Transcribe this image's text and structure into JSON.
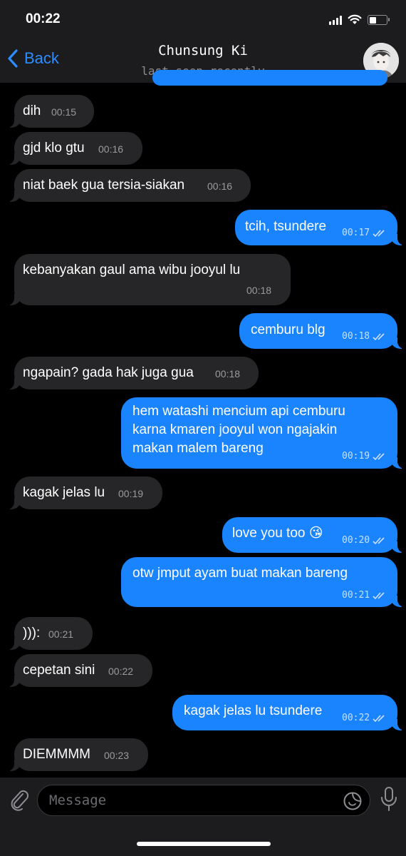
{
  "status": {
    "time": "00:22"
  },
  "nav": {
    "back_label": "Back",
    "contact_name": "Chunsung Ki",
    "contact_status": "last seen recently"
  },
  "messages": [
    {
      "dir": "in",
      "text": "dih",
      "time": "00:15"
    },
    {
      "dir": "in",
      "text": "gjd klo gtu",
      "time": "00:16"
    },
    {
      "dir": "in",
      "text": "niat baek gua tersia-siakan",
      "time": "00:16"
    },
    {
      "dir": "out",
      "text": "tcih, tsundere",
      "time": "00:17"
    },
    {
      "dir": "in",
      "text": "kebanyakan gaul ama wibu jooyul lu",
      "time": "00:18"
    },
    {
      "dir": "out",
      "text": "cemburu blg",
      "time": "00:18"
    },
    {
      "dir": "in",
      "text": "ngapain? gada hak juga gua",
      "time": "00:18"
    },
    {
      "dir": "out",
      "lines": [
        "hem watashi mencium api cemburu",
        "karna kmaren jooyul won ngajakin",
        "makan malem bareng"
      ],
      "time": "00:19"
    },
    {
      "dir": "in",
      "text": "kagak jelas lu",
      "time": "00:19"
    },
    {
      "dir": "out",
      "text": "love you too 😘",
      "time": "00:20"
    },
    {
      "dir": "out",
      "text": "otw jmput ayam buat makan bareng",
      "time": "00:21"
    },
    {
      "dir": "in",
      "text": "))):",
      "time": "00:21"
    },
    {
      "dir": "in",
      "text": "cepetan sini",
      "time": "00:22"
    },
    {
      "dir": "out",
      "text": "kagak jelas lu tsundere",
      "time": "00:22"
    },
    {
      "dir": "in",
      "text": "DIEMMMM",
      "time": "00:23"
    }
  ],
  "composer": {
    "placeholder": "Message"
  },
  "colors": {
    "accent": "#1a84ff",
    "incoming": "#262628",
    "background": "#000000",
    "bar": "#1c1c1e"
  }
}
